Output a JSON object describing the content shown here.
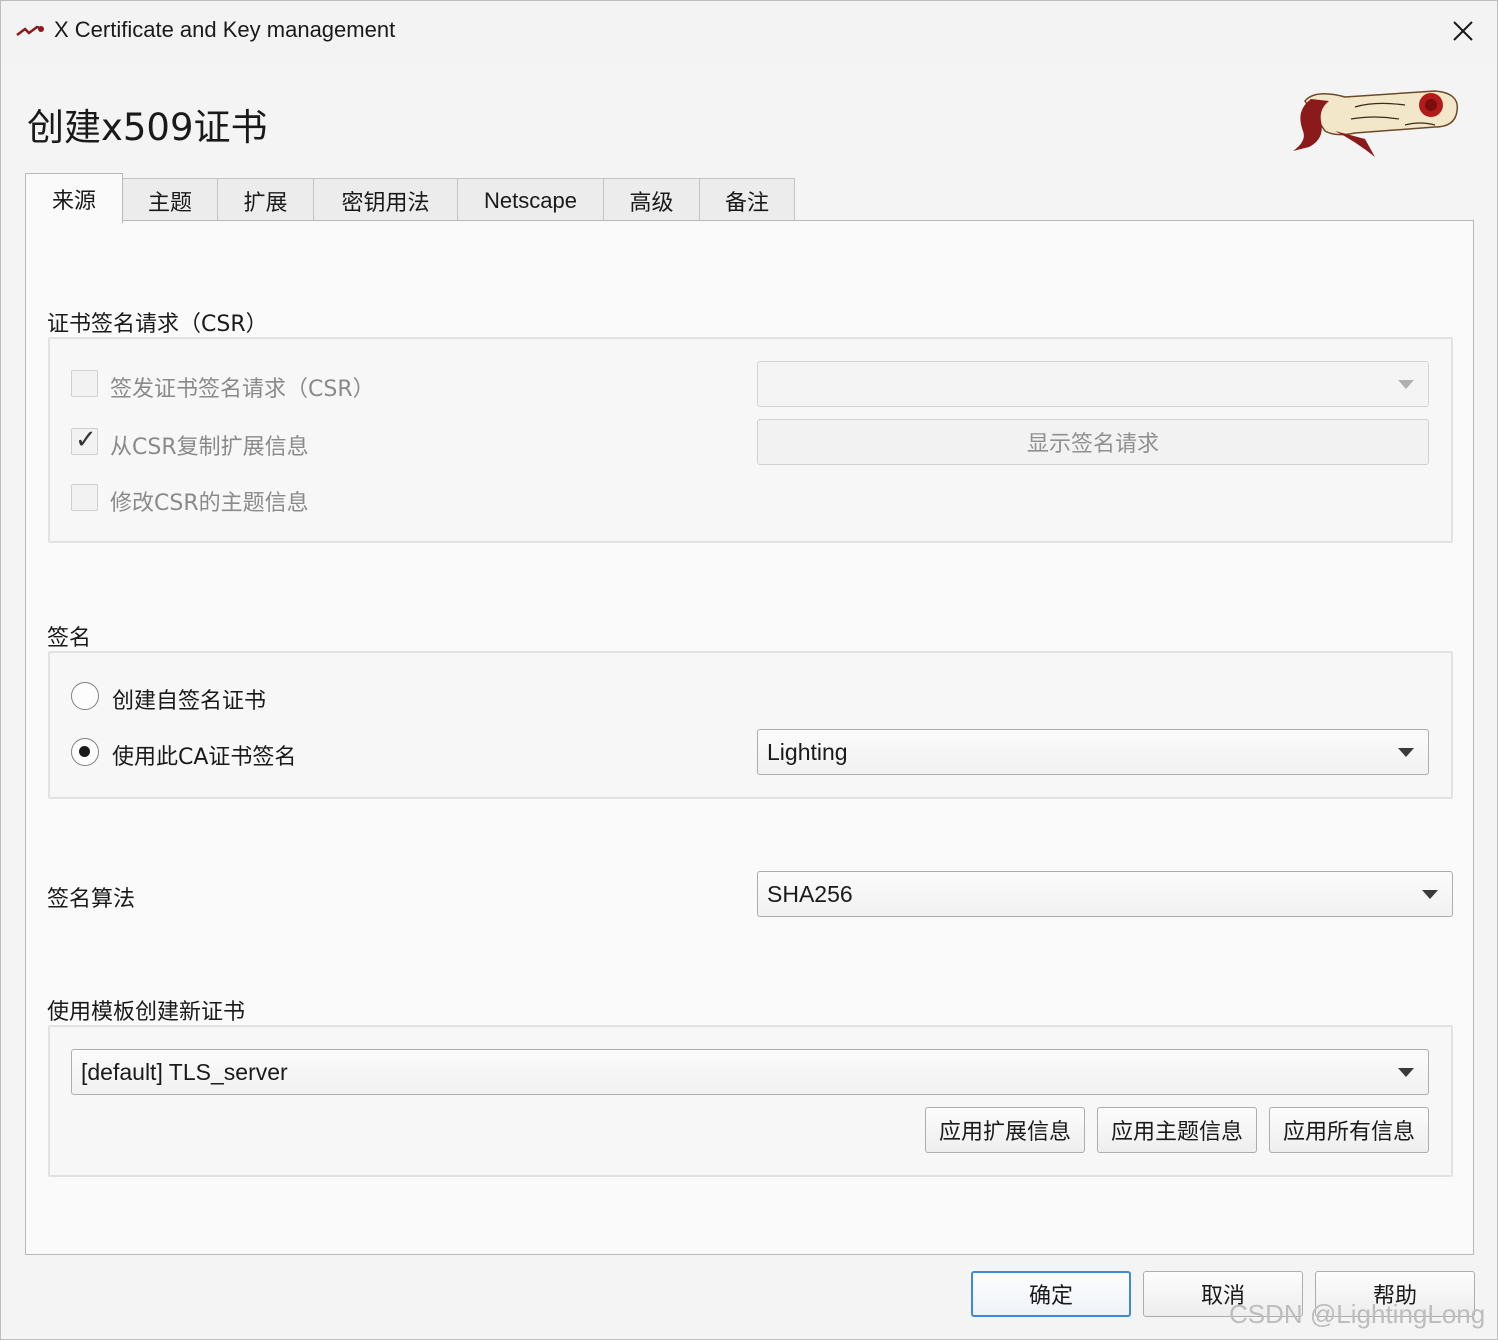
{
  "window": {
    "title": "X Certificate and Key management",
    "heading": "创建x509证书"
  },
  "tabs": [
    {
      "label": "来源",
      "active": true
    },
    {
      "label": "主题"
    },
    {
      "label": "扩展"
    },
    {
      "label": "密钥用法"
    },
    {
      "label": "Netscape"
    },
    {
      "label": "高级"
    },
    {
      "label": "备注"
    }
  ],
  "csr": {
    "group_label": "证书签名请求（CSR）",
    "sign_csr": {
      "label": "签发证书签名请求（CSR）",
      "checked": false
    },
    "copy_ext": {
      "label": "从CSR复制扩展信息",
      "checked": true
    },
    "modify_subject": {
      "label": "修改CSR的主题信息",
      "checked": false
    },
    "csr_combo_value": "",
    "show_request_button": "显示签名请求"
  },
  "signing": {
    "group_label": "签名",
    "self_signed": {
      "label": "创建自签名证书",
      "selected": false
    },
    "use_ca": {
      "label": "使用此CA证书签名",
      "selected": true
    },
    "ca_combo_value": "Lighting"
  },
  "algorithm": {
    "label": "签名算法",
    "value": "SHA256"
  },
  "template": {
    "group_label": "使用模板创建新证书",
    "value": "[default] TLS_server",
    "apply_ext_button": "应用扩展信息",
    "apply_subject_button": "应用主题信息",
    "apply_all_button": "应用所有信息"
  },
  "footer": {
    "ok_button": "确定",
    "cancel_button": "取消",
    "help_button": "帮助"
  },
  "watermark": "CSDN @LightingLong",
  "colors": {
    "default_button_border": "#3d8bd6",
    "logo_red": "#8b1a1a"
  }
}
